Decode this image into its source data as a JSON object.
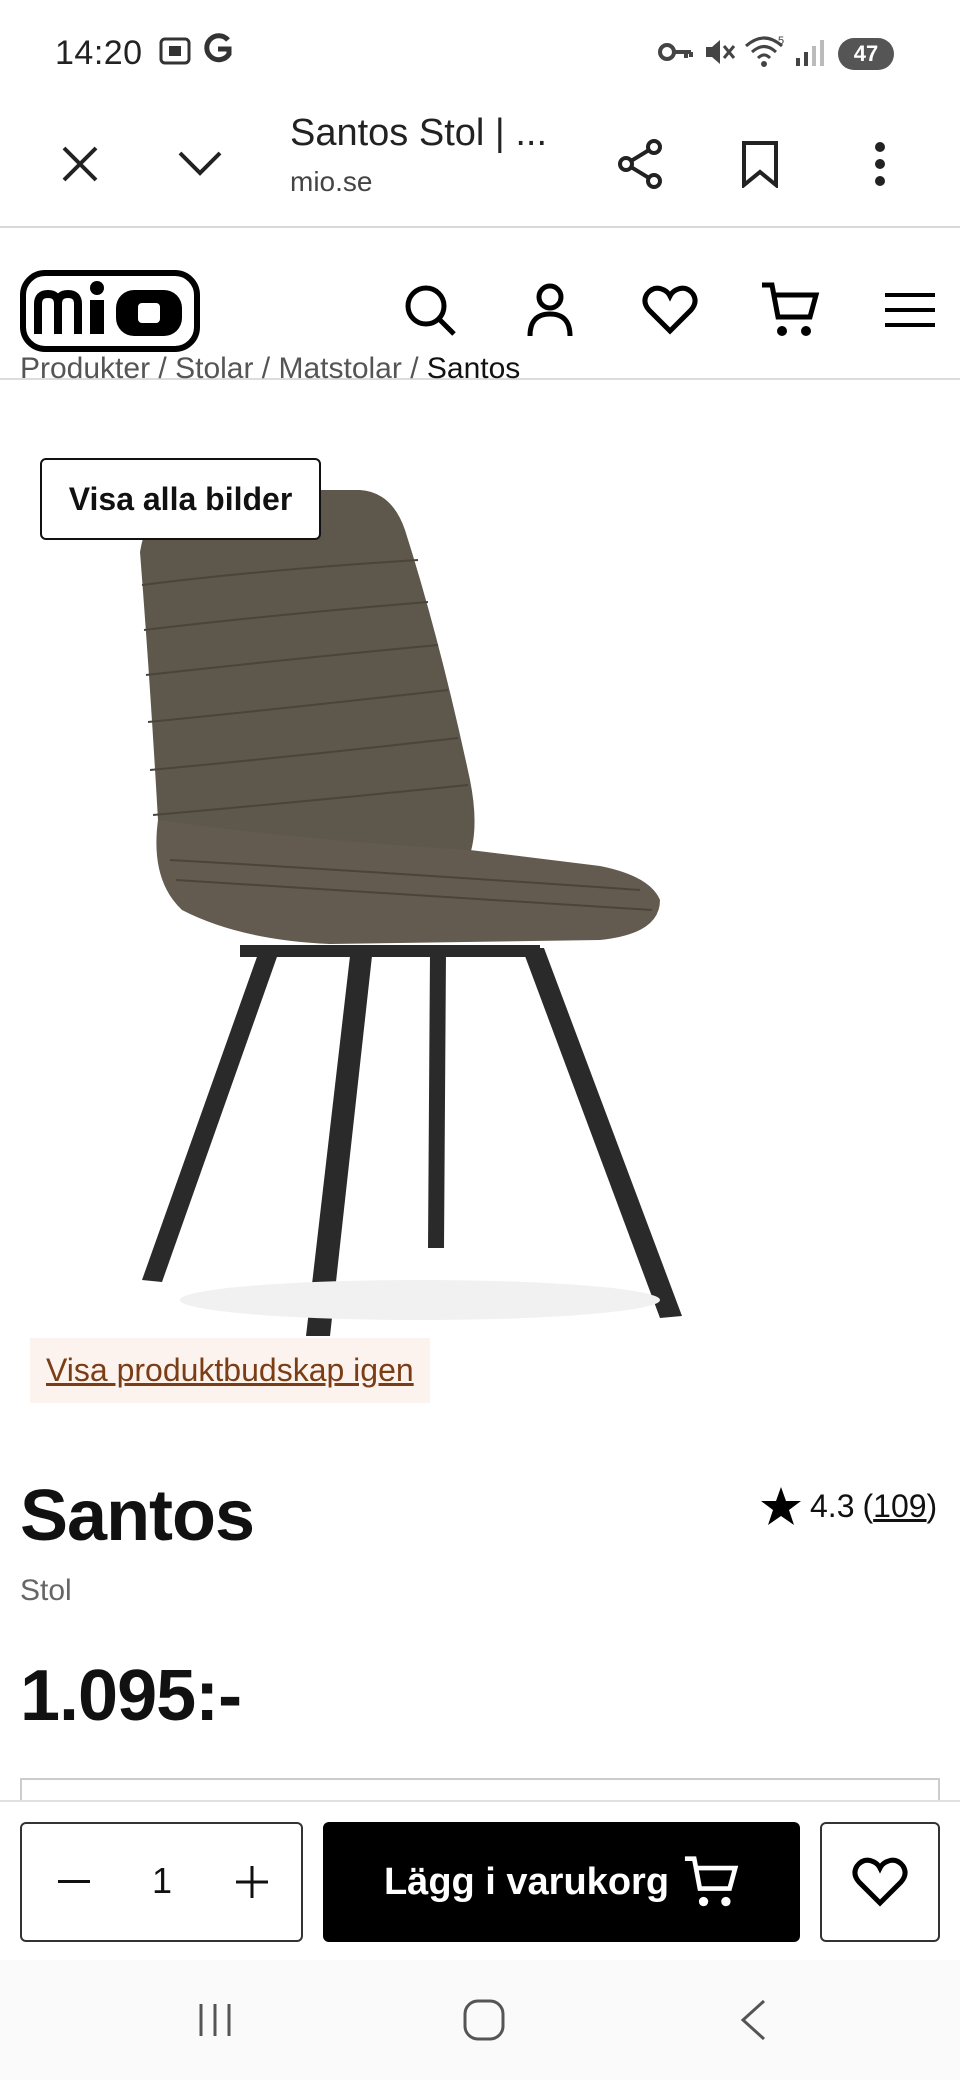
{
  "status_bar": {
    "time": "14:20",
    "battery": "47"
  },
  "browser": {
    "tab_title": "Santos Stol | ...",
    "url": "mio.se"
  },
  "breadcrumb": {
    "items": [
      "Produkter",
      "Stolar",
      "Matstolar"
    ],
    "current": "Santos",
    "separator": " / "
  },
  "gallery": {
    "show_all_label": "Visa alla bilder",
    "show_message_label": "Visa produktbudskap igen"
  },
  "product": {
    "name": "Santos",
    "type": "Stol",
    "price": "1.095:-",
    "rating": "4.3",
    "review_count": "109"
  },
  "buy_bar": {
    "quantity": "1",
    "add_to_cart_label": "Lägg i varukorg"
  },
  "colors": {
    "accent": "#000000",
    "message_bg": "#fdf3ee",
    "message_link": "#7a3d15",
    "chair_fabric": "#5e574c",
    "chair_legs": "#2a2a2a"
  }
}
